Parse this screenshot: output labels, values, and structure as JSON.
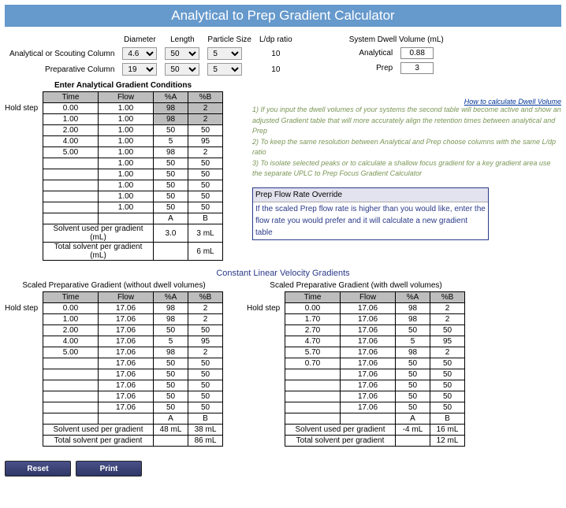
{
  "title": "Analytical to Prep Gradient Calculator",
  "params": {
    "headers": {
      "diameter": "Diameter",
      "length": "Length",
      "particle": "Particle Size",
      "ldp": "L/dp ratio"
    },
    "row_analytical_label": "Analytical or Scouting Column",
    "row_prep_label": "Preparative Column",
    "analytical": {
      "diameter": "4.6",
      "length": "50",
      "particle": "5",
      "ldp": "10"
    },
    "prep": {
      "diameter": "19",
      "length": "50",
      "particle": "5",
      "ldp": "10"
    },
    "dwell_title": "System Dwell Volume (mL)",
    "dwell_analytical_label": "Analytical",
    "dwell_prep_label": "Prep",
    "dwell_analytical_value": "0.88",
    "dwell_prep_value": "3",
    "link": "How to calculate Dwell Volume"
  },
  "conditions": {
    "title": "Enter Analytical Gradient Conditions",
    "hold_step": "Hold step",
    "headers": [
      "Time",
      "Flow",
      "%A",
      "%B"
    ],
    "rows": [
      {
        "time": "0.00",
        "flow": "1.00",
        "pa": "98",
        "pb": "2",
        "hl": true
      },
      {
        "time": "1.00",
        "flow": "1.00",
        "pa": "98",
        "pb": "2",
        "hl": true
      },
      {
        "time": "2.00",
        "flow": "1.00",
        "pa": "50",
        "pb": "50",
        "hl": false
      },
      {
        "time": "4.00",
        "flow": "1.00",
        "pa": "5",
        "pb": "95",
        "hl": false
      },
      {
        "time": "5.00",
        "flow": "1.00",
        "pa": "98",
        "pb": "2",
        "hl": false
      },
      {
        "time": "",
        "flow": "1.00",
        "pa": "50",
        "pb": "50",
        "hl": false
      },
      {
        "time": "",
        "flow": "1.00",
        "pa": "50",
        "pb": "50",
        "hl": false
      },
      {
        "time": "",
        "flow": "1.00",
        "pa": "50",
        "pb": "50",
        "hl": false
      },
      {
        "time": "",
        "flow": "1.00",
        "pa": "50",
        "pb": "50",
        "hl": false
      },
      {
        "time": "",
        "flow": "1.00",
        "pa": "50",
        "pb": "50",
        "hl": false
      }
    ],
    "ab_label_a": "A",
    "ab_label_b": "B",
    "solvent_row_label": "Solvent used per gradient (mL)",
    "solvent_a": "3.0",
    "solvent_b": "3 mL",
    "total_row_label": "Total solvent per gradient (mL)",
    "total_b": "6 mL"
  },
  "notes": {
    "n1": "1) If you input the dwell volumes of your systems the second table will become active and show an adjusted Gradient table that will more accurately align the retention times between analytical and Prep",
    "n2": "2) To keep the same resolution between Analytical and Prep choose columns with the same L/dp ratio",
    "n3": "3) To isolate selected peaks or to calculate a shallow focus gradient for a key gradient area use the separate UPLC to Prep Focus Gradient Calculator"
  },
  "override": {
    "head": "Prep Flow Rate Override",
    "body": "If the scaled Prep flow rate is higher than you would like, enter the flow rate you would prefer and it will calculate a new gradient table"
  },
  "section_title": "Constant Linear Velocity Gradients",
  "scaled1": {
    "title": "Scaled Preparative Gradient (without dwell volumes)",
    "hold_step": "Hold step",
    "rows": [
      {
        "time": "0.00",
        "flow": "17.06",
        "pa": "98",
        "pb": "2"
      },
      {
        "time": "1.00",
        "flow": "17.06",
        "pa": "98",
        "pb": "2"
      },
      {
        "time": "2.00",
        "flow": "17.06",
        "pa": "50",
        "pb": "50"
      },
      {
        "time": "4.00",
        "flow": "17.06",
        "pa": "5",
        "pb": "95"
      },
      {
        "time": "5.00",
        "flow": "17.06",
        "pa": "98",
        "pb": "2"
      },
      {
        "time": "",
        "flow": "17.06",
        "pa": "50",
        "pb": "50"
      },
      {
        "time": "",
        "flow": "17.06",
        "pa": "50",
        "pb": "50"
      },
      {
        "time": "",
        "flow": "17.06",
        "pa": "50",
        "pb": "50"
      },
      {
        "time": "",
        "flow": "17.06",
        "pa": "50",
        "pb": "50"
      },
      {
        "time": "",
        "flow": "17.06",
        "pa": "50",
        "pb": "50"
      }
    ],
    "solvent_row_label": "Solvent used per gradient",
    "solvent_a": "48 mL",
    "solvent_b": "38 mL",
    "total_row_label": "Total solvent per gradient",
    "total_b": "86 mL"
  },
  "scaled2": {
    "title": "Scaled Preparative Gradient (with dwell volumes)",
    "hold_step": "Hold step",
    "rows": [
      {
        "time": "0.00",
        "flow": "17.06",
        "pa": "98",
        "pb": "2"
      },
      {
        "time": "1.70",
        "flow": "17.06",
        "pa": "98",
        "pb": "2"
      },
      {
        "time": "2.70",
        "flow": "17.06",
        "pa": "50",
        "pb": "50"
      },
      {
        "time": "4.70",
        "flow": "17.06",
        "pa": "5",
        "pb": "95"
      },
      {
        "time": "5.70",
        "flow": "17.06",
        "pa": "98",
        "pb": "2"
      },
      {
        "time": "0.70",
        "flow": "17.06",
        "pa": "50",
        "pb": "50"
      },
      {
        "time": "",
        "flow": "17.06",
        "pa": "50",
        "pb": "50"
      },
      {
        "time": "",
        "flow": "17.06",
        "pa": "50",
        "pb": "50"
      },
      {
        "time": "",
        "flow": "17.06",
        "pa": "50",
        "pb": "50"
      },
      {
        "time": "",
        "flow": "17.06",
        "pa": "50",
        "pb": "50"
      }
    ],
    "solvent_row_label": "Solvent used per gradient",
    "solvent_a": "-4 mL",
    "solvent_b": "16 mL",
    "total_row_label": "Total solvent per gradient",
    "total_b": "12 mL"
  },
  "buttons": {
    "reset": "Reset",
    "print": "Print"
  }
}
